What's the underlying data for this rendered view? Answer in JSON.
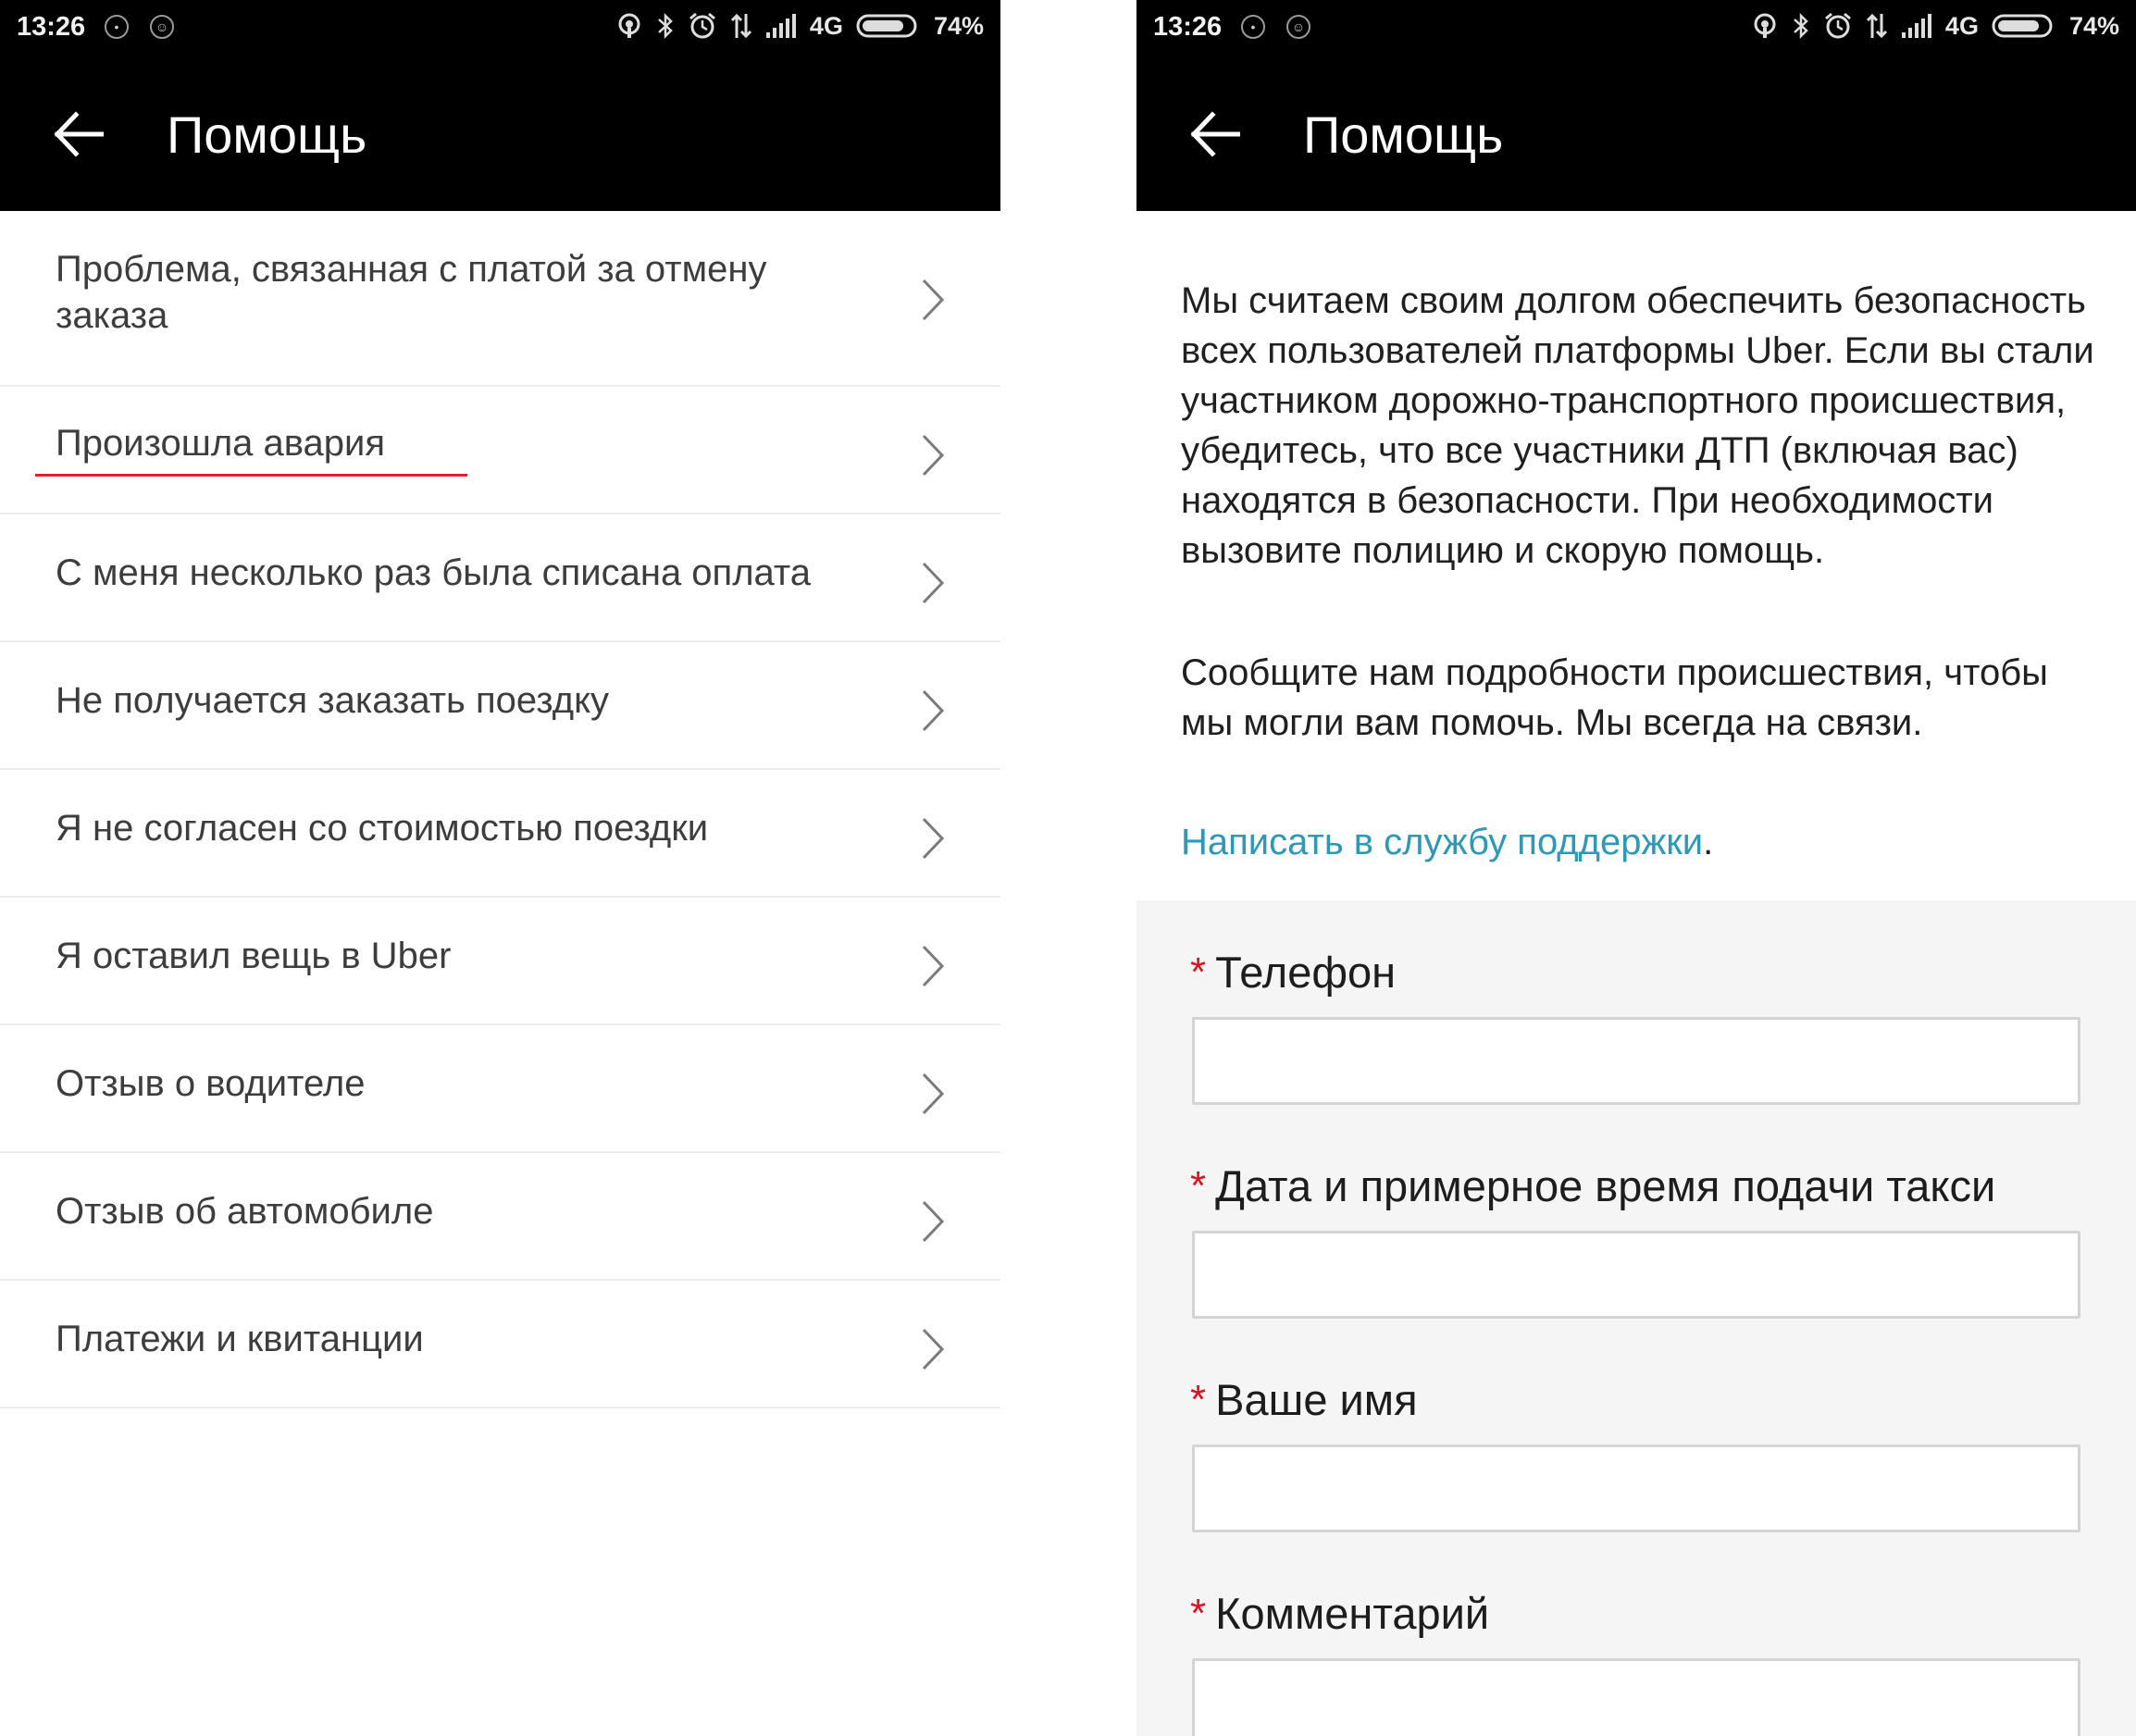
{
  "status_bar": {
    "time": "13:26",
    "network": "4G",
    "battery": "74%",
    "icons": [
      "hotspot-icon",
      "bluetooth-icon",
      "alarm-icon",
      "data-transfer-icon",
      "signal-icon",
      "battery-icon"
    ]
  },
  "left_screen": {
    "title": "Помощь",
    "items": [
      {
        "label": "Проблема, связанная с платой за отмену заказа"
      },
      {
        "label": "Произошла авария"
      },
      {
        "label": "С меня несколько раз была списана оплата"
      },
      {
        "label": "Не получается заказать поездку"
      },
      {
        "label": "Я не согласен со стоимостью поездки"
      },
      {
        "label": "Я оставил вещь в Uber"
      },
      {
        "label": "Отзыв о водителе"
      },
      {
        "label": "Отзыв об автомобиле"
      },
      {
        "label": "Платежи и квитанции"
      }
    ]
  },
  "right_screen": {
    "title": "Помощь",
    "paragraph_1": "Мы считаем своим долгом обеспечить безопасность всех пользователей платформы Uber. Если вы стали участником дорожно-транспортного происшествия, убедитесь, что все участники ДТП (включая вас) находятся в безопасности. При необходимости вызовите полицию и скорую помощь.",
    "paragraph_2": "Сообщите нам подробности происшествия, чтобы мы могли вам помочь. Мы всегда на связи.",
    "support_link": "Написать в службу поддержки",
    "support_link_suffix": ".",
    "required_mark": "*",
    "fields": [
      {
        "label": "Телефон",
        "value": ""
      },
      {
        "label": "Дата и примерное время подачи такси",
        "value": ""
      },
      {
        "label": "Ваше имя",
        "value": ""
      },
      {
        "label": "Комментарий",
        "value": ""
      }
    ]
  },
  "colors": {
    "bar_background": "#000000",
    "link": "#2b99b8",
    "required": "#e0101e",
    "highlight_underline": "#e0202e",
    "form_background": "#f5f5f5"
  }
}
